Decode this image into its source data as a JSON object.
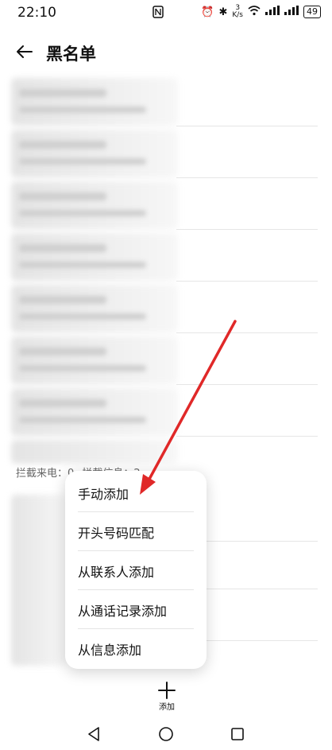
{
  "status_bar": {
    "time": "22:10",
    "nfc_icon": "nfc-icon",
    "speed_top": "3",
    "speed_unit": "K/s",
    "battery": "49"
  },
  "header": {
    "title": "黑名单",
    "back_icon": "back-arrow-icon"
  },
  "stats": {
    "calls_label": "拦截来电：0",
    "sms_label": "拦截信息：2"
  },
  "add_menu": {
    "items": [
      "手动添加",
      "开头号码匹配",
      "从联系人添加",
      "从通话记录添加",
      "从信息添加"
    ]
  },
  "bottom_action": {
    "add_label": "添加",
    "icon": "plus-icon"
  },
  "colors": {
    "annotation_arrow": "#e02828",
    "menu_background": "#ffffff"
  }
}
